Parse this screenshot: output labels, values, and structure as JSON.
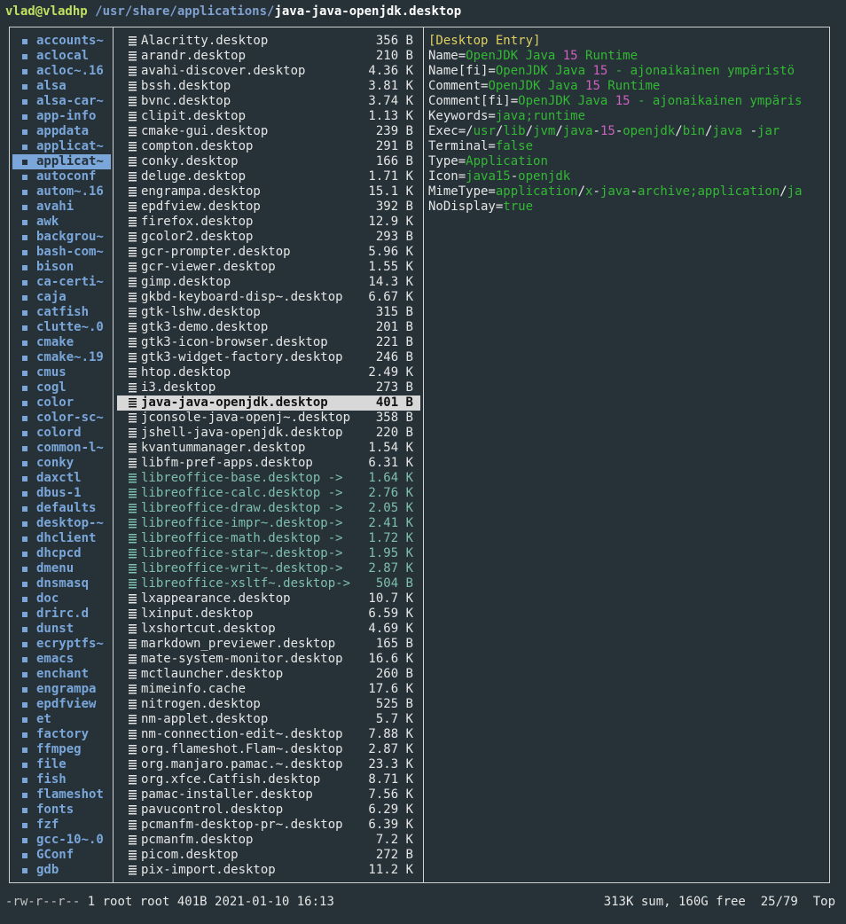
{
  "title": {
    "user_host": "vlad@vladhp",
    "path": " /usr/share/applications/",
    "file": "java-java-openjdk.desktop"
  },
  "parent_dirs": [
    "accounts~",
    "aclocal",
    "acloc~.16",
    "alsa",
    "alsa-car~",
    "app-info",
    "appdata",
    "applicat~",
    "applicat~",
    "autoconf",
    "autom~.16",
    "avahi",
    "awk",
    "backgrou~",
    "bash-com~",
    "bison",
    "ca-certi~",
    "caja",
    "catfish",
    "clutte~.0",
    "cmake",
    "cmake~.19",
    "cmus",
    "cogl",
    "color",
    "color-sc~",
    "colord",
    "common-l~",
    "conky",
    "daxctl",
    "dbus-1",
    "defaults",
    "desktop-~",
    "dhclient",
    "dhcpcd",
    "dmenu",
    "dnsmasq",
    "doc",
    "drirc.d",
    "dunst",
    "ecryptfs~",
    "emacs",
    "enchant",
    "engrampa",
    "epdfview",
    "et",
    "factory",
    "ffmpeg",
    "file",
    "fish",
    "flameshot",
    "fonts",
    "fzf",
    "gcc-10~.0",
    "GConf",
    "gdb"
  ],
  "parent_selected_index": 8,
  "files": [
    {
      "name": "Alacritty.desktop",
      "size": "356 B"
    },
    {
      "name": "arandr.desktop",
      "size": "210 B"
    },
    {
      "name": "avahi-discover.desktop",
      "size": "4.36 K"
    },
    {
      "name": "bssh.desktop",
      "size": "3.81 K"
    },
    {
      "name": "bvnc.desktop",
      "size": "3.74 K"
    },
    {
      "name": "clipit.desktop",
      "size": "1.13 K"
    },
    {
      "name": "cmake-gui.desktop",
      "size": "239 B"
    },
    {
      "name": "compton.desktop",
      "size": "291 B"
    },
    {
      "name": "conky.desktop",
      "size": "166 B"
    },
    {
      "name": "deluge.desktop",
      "size": "1.71 K"
    },
    {
      "name": "engrampa.desktop",
      "size": "15.1 K"
    },
    {
      "name": "epdfview.desktop",
      "size": "392 B"
    },
    {
      "name": "firefox.desktop",
      "size": "12.9 K"
    },
    {
      "name": "gcolor2.desktop",
      "size": "293 B"
    },
    {
      "name": "gcr-prompter.desktop",
      "size": "5.96 K"
    },
    {
      "name": "gcr-viewer.desktop",
      "size": "1.55 K"
    },
    {
      "name": "gimp.desktop",
      "size": "14.3 K"
    },
    {
      "name": "gkbd-keyboard-disp~.desktop",
      "size": "6.67 K"
    },
    {
      "name": "gtk-lshw.desktop",
      "size": "315 B"
    },
    {
      "name": "gtk3-demo.desktop",
      "size": "201 B"
    },
    {
      "name": "gtk3-icon-browser.desktop",
      "size": "221 B"
    },
    {
      "name": "gtk3-widget-factory.desktop",
      "size": "246 B"
    },
    {
      "name": "htop.desktop",
      "size": "2.49 K"
    },
    {
      "name": "i3.desktop",
      "size": "273 B"
    },
    {
      "name": "java-java-openjdk.desktop",
      "size": "401 B",
      "selected": true
    },
    {
      "name": "jconsole-java-openj~.desktop",
      "size": "358 B"
    },
    {
      "name": "jshell-java-openjdk.desktop",
      "size": "220 B"
    },
    {
      "name": "kvantummanager.desktop",
      "size": "1.54 K"
    },
    {
      "name": "libfm-pref-apps.desktop",
      "size": "6.31 K"
    },
    {
      "name": "libreoffice-base.desktop ->",
      "size": "1.64 K",
      "link": true
    },
    {
      "name": "libreoffice-calc.desktop ->",
      "size": "2.76 K",
      "link": true
    },
    {
      "name": "libreoffice-draw.desktop ->",
      "size": "2.05 K",
      "link": true
    },
    {
      "name": "libreoffice-impr~.desktop->",
      "size": "2.41 K",
      "link": true
    },
    {
      "name": "libreoffice-math.desktop ->",
      "size": "1.72 K",
      "link": true
    },
    {
      "name": "libreoffice-star~.desktop->",
      "size": "1.95 K",
      "link": true
    },
    {
      "name": "libreoffice-writ~.desktop->",
      "size": "2.87 K",
      "link": true
    },
    {
      "name": "libreoffice-xsltf~.desktop->",
      "size": "504 B",
      "link": true
    },
    {
      "name": "lxappearance.desktop",
      "size": "10.7 K"
    },
    {
      "name": "lxinput.desktop",
      "size": "6.59 K"
    },
    {
      "name": "lxshortcut.desktop",
      "size": "4.69 K"
    },
    {
      "name": "markdown_previewer.desktop",
      "size": "165 B"
    },
    {
      "name": "mate-system-monitor.desktop",
      "size": "16.6 K"
    },
    {
      "name": "mctlauncher.desktop",
      "size": "260 B"
    },
    {
      "name": "mimeinfo.cache",
      "size": "17.6 K"
    },
    {
      "name": "nitrogen.desktop",
      "size": "525 B"
    },
    {
      "name": "nm-applet.desktop",
      "size": "5.7 K"
    },
    {
      "name": "nm-connection-edit~.desktop",
      "size": "7.88 K"
    },
    {
      "name": "org.flameshot.Flam~.desktop",
      "size": "2.87 K"
    },
    {
      "name": "org.manjaro.pamac.~.desktop",
      "size": "23.3 K"
    },
    {
      "name": "org.xfce.Catfish.desktop",
      "size": "8.71 K"
    },
    {
      "name": "pamac-installer.desktop",
      "size": "7.56 K"
    },
    {
      "name": "pavucontrol.desktop",
      "size": "6.29 K"
    },
    {
      "name": "pcmanfm-desktop-pr~.desktop",
      "size": "6.39 K"
    },
    {
      "name": "pcmanfm.desktop",
      "size": "7.2 K"
    },
    {
      "name": "picom.desktop",
      "size": "272 B"
    },
    {
      "name": "pix-import.desktop",
      "size": "11.2 K"
    }
  ],
  "preview": [
    [
      {
        "t": "[Desktop Entry]",
        "c": "sect"
      }
    ],
    [
      {
        "t": "Name="
      },
      {
        "t": "OpenJDK Java ",
        "c": "val"
      },
      {
        "t": "15",
        "c": "num"
      },
      {
        "t": " Runtime",
        "c": "val"
      }
    ],
    [
      {
        "t": "Name[fi]="
      },
      {
        "t": "OpenJDK Java ",
        "c": "val"
      },
      {
        "t": "15",
        "c": "num"
      },
      {
        "t": " - ajonaikainen ympäristö",
        "c": "val"
      }
    ],
    [
      {
        "t": "Comment="
      },
      {
        "t": "OpenJDK Java ",
        "c": "val"
      },
      {
        "t": "15",
        "c": "num"
      },
      {
        "t": " Runtime",
        "c": "val"
      }
    ],
    [
      {
        "t": "Comment[fi]="
      },
      {
        "t": "OpenJDK Java ",
        "c": "val"
      },
      {
        "t": "15",
        "c": "num"
      },
      {
        "t": " - ajonaikainen ympäris",
        "c": "val"
      }
    ],
    [
      {
        "t": "Keywords="
      },
      {
        "t": "java;runtime",
        "c": "val"
      }
    ],
    [
      {
        "t": "Exec="
      },
      {
        "t": "/"
      },
      {
        "t": "usr",
        "c": "val"
      },
      {
        "t": "/"
      },
      {
        "t": "lib",
        "c": "val"
      },
      {
        "t": "/"
      },
      {
        "t": "jvm",
        "c": "val"
      },
      {
        "t": "/"
      },
      {
        "t": "java",
        "c": "val"
      },
      {
        "t": "-"
      },
      {
        "t": "15",
        "c": "num"
      },
      {
        "t": "-"
      },
      {
        "t": "openjdk",
        "c": "val"
      },
      {
        "t": "/"
      },
      {
        "t": "bin",
        "c": "val"
      },
      {
        "t": "/"
      },
      {
        "t": "java",
        "c": "val"
      },
      {
        "t": " -"
      },
      {
        "t": "jar",
        "c": "val"
      }
    ],
    [
      {
        "t": "Terminal="
      },
      {
        "t": "false",
        "c": "val"
      }
    ],
    [
      {
        "t": "Type="
      },
      {
        "t": "Application",
        "c": "val"
      }
    ],
    [
      {
        "t": "Icon="
      },
      {
        "t": "java15",
        "c": "val"
      },
      {
        "t": "-"
      },
      {
        "t": "openjdk",
        "c": "val"
      }
    ],
    [
      {
        "t": "MimeType="
      },
      {
        "t": "application",
        "c": "val"
      },
      {
        "t": "/"
      },
      {
        "t": "x",
        "c": "val"
      },
      {
        "t": "-"
      },
      {
        "t": "java",
        "c": "val"
      },
      {
        "t": "-"
      },
      {
        "t": "archive;application",
        "c": "val"
      },
      {
        "t": "/"
      },
      {
        "t": "ja",
        "c": "val"
      }
    ],
    [
      {
        "t": "NoDisplay="
      },
      {
        "t": "true",
        "c": "val"
      }
    ]
  ],
  "status": {
    "permissions": "-rw-r--r--",
    "info": " 1 root root 401B 2021-01-10 16:13",
    "right": "313K sum, 160G free  25/79  Top"
  },
  "colors": {
    "background": "#263238",
    "dir": "#7aa6da",
    "symlink": "#7fbfae",
    "value": "#33b833",
    "number": "#d060c0",
    "section": "#e0d060"
  }
}
